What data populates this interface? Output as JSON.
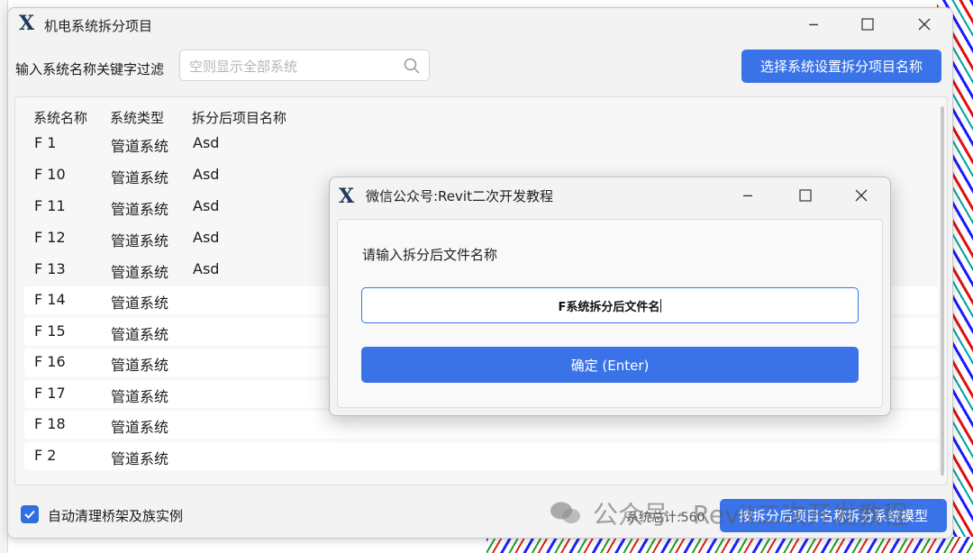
{
  "main_window": {
    "title": "机电系统拆分项目",
    "filter_label": "输入系统名称关键字过滤",
    "search_placeholder": "空则显示全部系统",
    "select_button": "选择系统设置拆分项目名称",
    "columns": [
      "系统名称",
      "系统类型",
      "拆分后项目名称"
    ],
    "rows": [
      {
        "name": "F 1",
        "type": "管道系统",
        "project": "Asd"
      },
      {
        "name": "F 10",
        "type": "管道系统",
        "project": "Asd"
      },
      {
        "name": "F 11",
        "type": "管道系统",
        "project": "Asd"
      },
      {
        "name": "F 12",
        "type": "管道系统",
        "project": "Asd"
      },
      {
        "name": "F 13",
        "type": "管道系统",
        "project": "Asd"
      },
      {
        "name": "F 14",
        "type": "管道系统",
        "project": ""
      },
      {
        "name": "F 15",
        "type": "管道系统",
        "project": ""
      },
      {
        "name": "F 16",
        "type": "管道系统",
        "project": ""
      },
      {
        "name": "F 17",
        "type": "管道系统",
        "project": ""
      },
      {
        "name": "F 18",
        "type": "管道系统",
        "project": ""
      },
      {
        "name": "F 2",
        "type": "管道系统",
        "project": ""
      }
    ],
    "checkbox_label": "自动清理桥架及族实例",
    "checkbox_checked": true,
    "status_text": "系统总计:560",
    "split_button": "按拆分后项目名称拆分系统模型"
  },
  "dialog": {
    "title": "微信公众号:Revit二次开发教程",
    "prompt": "请输入拆分后文件名称",
    "input_value": "F系统拆分后文件名",
    "ok_button": "确定 (Enter)"
  },
  "watermark": "公众号 · Revit二次开发教程",
  "colors": {
    "accent": "#3a73e8",
    "window_bg": "#f3f3f3"
  },
  "icons": [
    "app-logo-icon",
    "minimize-icon",
    "maximize-icon",
    "close-icon",
    "search-icon",
    "checkmark-icon"
  ]
}
